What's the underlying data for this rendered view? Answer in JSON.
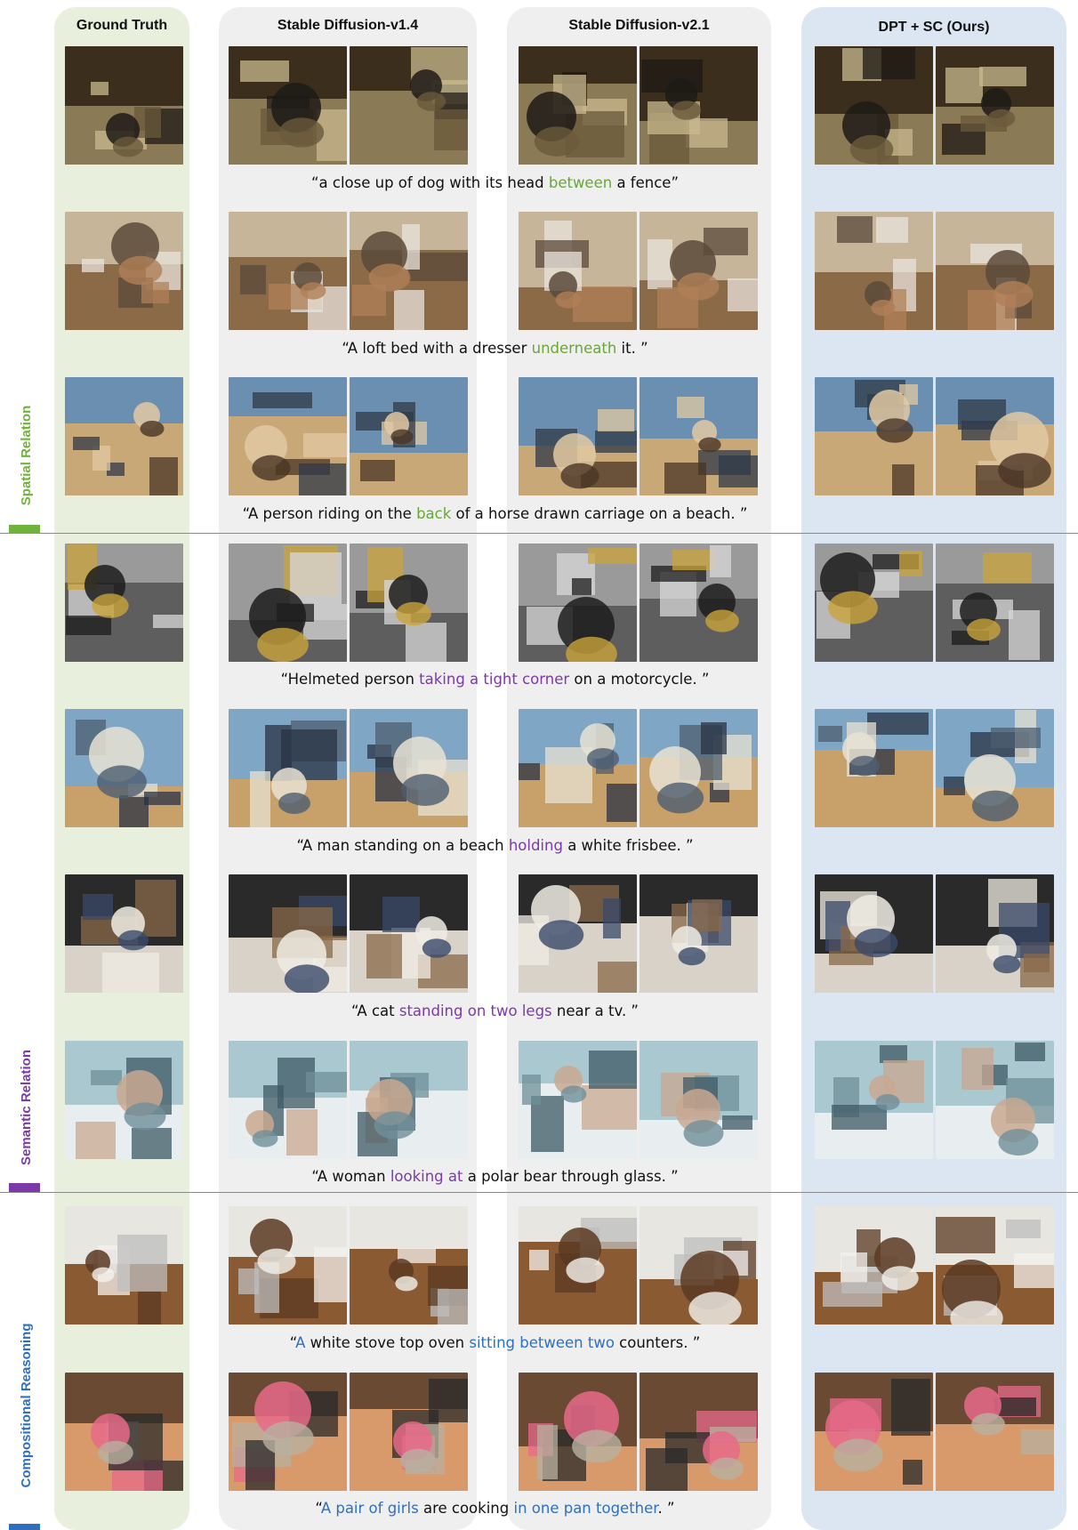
{
  "columns": {
    "ground_truth": "Ground Truth",
    "sd14": "Stable Diffusion-v1.4",
    "sd21": "Stable Diffusion-v2.1",
    "ours": "DPT + SC (Ours)"
  },
  "categories": [
    {
      "label": "Spatial Relation",
      "color": "#6fb33a"
    },
    {
      "label": "Semantic Relation",
      "color": "#7b3aa8"
    },
    {
      "label": "Compositional Reasoning",
      "color": "#2f6fbf"
    }
  ],
  "colors": {
    "spatial": "#6aa63a",
    "semantic": "#7b3aa8",
    "compositional": "#2f6fbf"
  },
  "rows": [
    {
      "caption": [
        {
          "t": "“a close up of dog with its head ",
          "c": ""
        },
        {
          "t": "between",
          "c": "#6aa63a"
        },
        {
          "t": " a fence”",
          "c": ""
        }
      ],
      "subject": "dog and fence"
    },
    {
      "caption": [
        {
          "t": "“A loft bed with a dresser ",
          "c": ""
        },
        {
          "t": "underneath",
          "c": "#6aa63a"
        },
        {
          "t": " it. ”",
          "c": ""
        }
      ],
      "subject": "loft bed"
    },
    {
      "caption": [
        {
          "t": "“A person riding on the ",
          "c": ""
        },
        {
          "t": "back",
          "c": "#6aa63a"
        },
        {
          "t": " of a horse drawn carriage on a beach. ”",
          "c": ""
        }
      ],
      "subject": "horse carriage beach"
    },
    {
      "caption": [
        {
          "t": "“Helmeted person ",
          "c": ""
        },
        {
          "t": "taking a tight corner",
          "c": "#7b3aa8"
        },
        {
          "t": " on a motorcycle. ”",
          "c": ""
        }
      ],
      "subject": "motorcycle"
    },
    {
      "caption": [
        {
          "t": "“A man standing on a beach ",
          "c": ""
        },
        {
          "t": "holding",
          "c": "#7b3aa8"
        },
        {
          "t": " a white frisbee. ”",
          "c": ""
        }
      ],
      "subject": "man with frisbee"
    },
    {
      "caption": [
        {
          "t": "“A cat ",
          "c": ""
        },
        {
          "t": "standing on two legs",
          "c": "#7b3aa8"
        },
        {
          "t": " near a tv. ”",
          "c": ""
        }
      ],
      "subject": "cat near tv"
    },
    {
      "caption": [
        {
          "t": "“A woman ",
          "c": ""
        },
        {
          "t": "looking at",
          "c": "#7b3aa8"
        },
        {
          "t": " a polar bear through glass. ”",
          "c": ""
        }
      ],
      "subject": "polar bear"
    },
    {
      "caption": [
        {
          "t": "“",
          "c": ""
        },
        {
          "t": "A",
          "c": "#2f6fbf"
        },
        {
          "t": " white stove top oven ",
          "c": ""
        },
        {
          "t": "sitting between two",
          "c": "#2f6fbf"
        },
        {
          "t": " counters. ”",
          "c": ""
        }
      ],
      "subject": "stove oven"
    },
    {
      "caption": [
        {
          "t": "“",
          "c": ""
        },
        {
          "t": "A pair of girls",
          "c": "#2f6fbf"
        },
        {
          "t": " are cooking ",
          "c": ""
        },
        {
          "t": "in one pan together",
          "c": "#2f6fbf"
        },
        {
          "t": ". ”",
          "c": ""
        }
      ],
      "subject": "girls cooking"
    }
  ]
}
